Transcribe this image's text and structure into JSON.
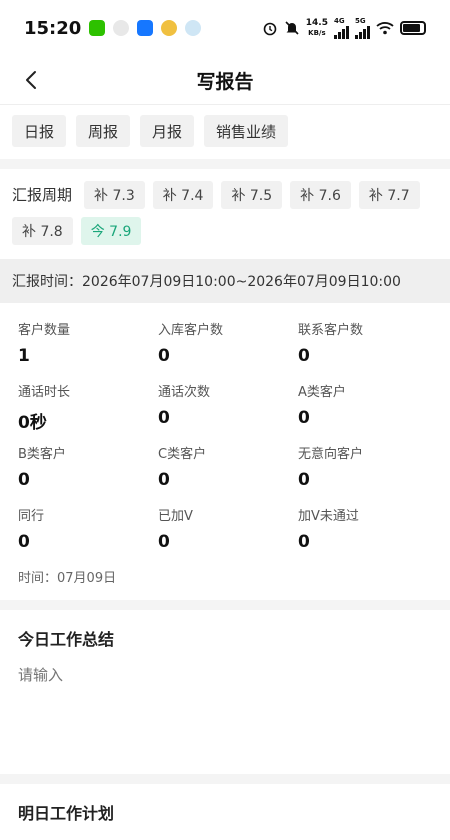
{
  "status_bar": {
    "time": "15:20",
    "net_speed_value": "14.5",
    "net_speed_unit": "KB/s",
    "net1": "4G",
    "net2": "5G",
    "battery_level": 0.85
  },
  "nav": {
    "title": "写报告"
  },
  "tabs": [
    {
      "label": "日报",
      "active": true
    },
    {
      "label": "周报",
      "active": false
    },
    {
      "label": "月报",
      "active": false
    },
    {
      "label": "销售业绩",
      "active": false
    }
  ],
  "period": {
    "label": "汇报周期",
    "chips": [
      "补 7.3",
      "补 7.4",
      "补 7.5",
      "补 7.6",
      "补 7.7",
      "补 7.8",
      "今 7.9"
    ]
  },
  "report_time": "汇报时间：2026年07月09日10:00~2026年07月09日10:00",
  "stats": [
    {
      "label": "客户数量",
      "value": "1"
    },
    {
      "label": "入库客户数",
      "value": "0"
    },
    {
      "label": "联系客户数",
      "value": "0"
    },
    {
      "label": "通话时长",
      "value": "0秒"
    },
    {
      "label": "通话次数",
      "value": "0"
    },
    {
      "label": "A类客户",
      "value": "0"
    },
    {
      "label": "B类客户",
      "value": "0"
    },
    {
      "label": "C类客户",
      "value": "0"
    },
    {
      "label": "无意向客户",
      "value": "0"
    },
    {
      "label": "同行",
      "value": "0"
    },
    {
      "label": "已加V",
      "value": "0"
    },
    {
      "label": "加V未通过",
      "value": "0"
    }
  ],
  "stats_date": "时间：07月09日",
  "summary": {
    "title": "今日工作总结",
    "placeholder": "请输入"
  },
  "plan": {
    "title": "明日工作计划"
  },
  "colors": {
    "accent": "#1aa67a",
    "accent_bg": "#dff5ec"
  }
}
